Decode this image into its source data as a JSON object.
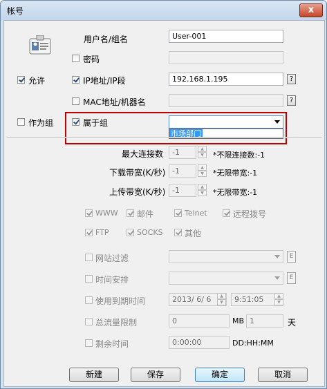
{
  "window": {
    "title": "帐号",
    "close_glyph": "x"
  },
  "account": {
    "username_label": "用户名/组名",
    "username_value": "User-001",
    "password_label": "密码",
    "password_value": "",
    "allow_label": "允许",
    "ip_label": "IP地址/IP段",
    "ip_value": "192.168.1.195",
    "mac_label": "MAC地址/机器名",
    "mac_value": "",
    "help_glyph": "?",
    "as_group_label": "作为组",
    "belong_group_label": "属于组",
    "belong_group_value": "",
    "group_dropdown_option": "市场部门"
  },
  "limits": {
    "max_conn_label": "最大连接数",
    "max_conn_value": "-1",
    "max_conn_hint": "*不限连接数:-1",
    "download_label": "下载带宽(K/秒)",
    "download_value": "-1",
    "download_hint": "*无限带宽:-1",
    "upload_label": "上传带宽(K/秒)",
    "upload_value": "-1",
    "upload_hint": "*无限带宽:-1"
  },
  "services": [
    "WWW",
    "邮件",
    "Telnet",
    "远程拨号",
    "FTP",
    "SOCKS",
    "其他"
  ],
  "options": {
    "site_filter_label": "网站过滤",
    "time_schedule_label": "时间安排",
    "expiry_label": "使用到期时间",
    "expiry_date": "2013/ 6/ 6",
    "expiry_time": "9:51:05",
    "traffic_label": "总流量限制",
    "traffic_value": "0",
    "traffic_unit": "MB",
    "traffic_days_value": "1",
    "traffic_days_unit": "天",
    "remaining_label": "剩余时间",
    "remaining_value": "0:00:00",
    "remaining_format": "DD:HH:MM",
    "edit_glyph": "E"
  },
  "buttons": {
    "new": "新建",
    "save": "保存",
    "ok": "确定",
    "cancel": "取消"
  },
  "colors": {
    "highlight_border": "#c00000",
    "selection": "#3399ff"
  }
}
